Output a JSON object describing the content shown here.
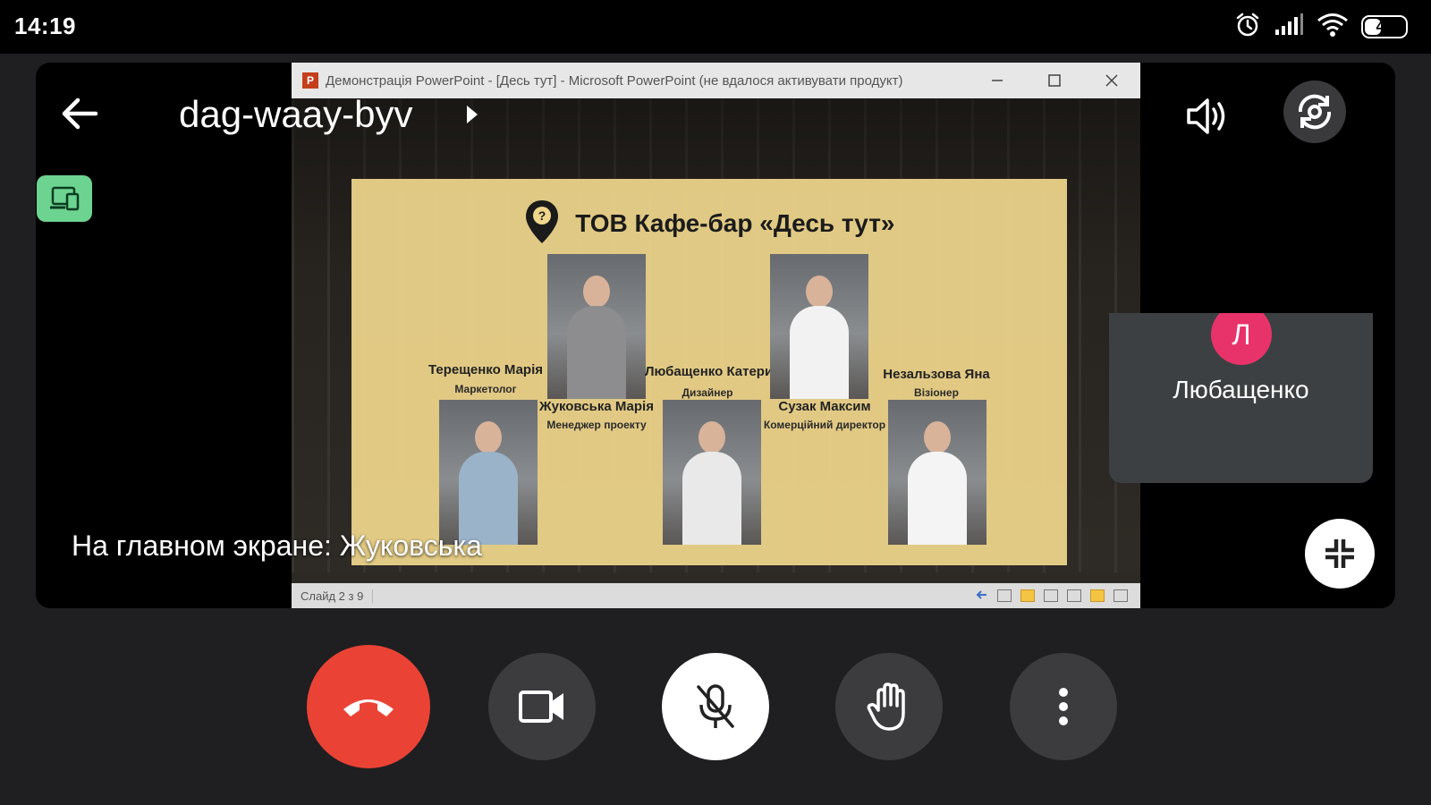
{
  "status_bar": {
    "time": "14:19",
    "battery": "46",
    "battery_level": 0.46
  },
  "meeting": {
    "code": "dag-waay-byv",
    "main_screen_label": "На главном экране: Жуковська"
  },
  "participant": {
    "initial": "Л",
    "name": "Любащенко",
    "avatar_color": "#e8336a"
  },
  "shared_window": {
    "title": "Демонстрація PowerPoint - [Десь тут] - Microsoft PowerPoint (не вдалося активувати продукт)",
    "logo_letter": "P",
    "status_slide": "Слайд 2 з 9",
    "slide": {
      "title": "ТОВ Кафе-бар «Десь тут»",
      "people": [
        {
          "name": "Терещенко Марія",
          "role": "Маркетолог",
          "outfit_color": "#9ab3c9"
        },
        {
          "name": "Жуковська Марія",
          "role": "Менеджер проекту",
          "outfit_color": "#8d8d8f"
        },
        {
          "name": "Любащенко Катерина",
          "role": "Дизайнер",
          "outfit_color": "#e9e9e9"
        },
        {
          "name": "Сузак Максим",
          "role": "Комерційний директор",
          "outfit_color": "#f2f2f2"
        },
        {
          "name": "Незальзова Яна",
          "role": "Візіонер",
          "outfit_color": "#f4f4f4"
        }
      ]
    }
  },
  "colors": {
    "end_call": "#ea4335",
    "present_badge": "#6dd391",
    "control_bg": "#3c3c3e"
  },
  "icons": [
    "arrow-left-icon",
    "chevron-right-icon",
    "present-screen-icon",
    "volume-icon",
    "rotate-camera-icon",
    "collapse-icon",
    "phone-hangup-icon",
    "video-camera-icon",
    "mic-off-icon",
    "raise-hand-icon",
    "more-vert-icon"
  ]
}
